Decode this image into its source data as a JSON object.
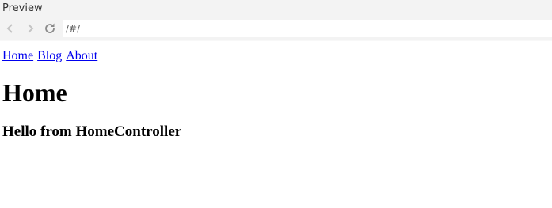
{
  "window": {
    "title": "Preview"
  },
  "toolbar": {
    "back_icon": "chevron-left-icon",
    "forward_icon": "chevron-right-icon",
    "refresh_icon": "refresh-icon",
    "url": "/#/"
  },
  "nav_links": [
    {
      "label": "Home"
    },
    {
      "label": "Blog"
    },
    {
      "label": "About"
    }
  ],
  "page": {
    "heading": "Home",
    "subheading": "Hello from HomeController"
  },
  "colors": {
    "chrome_bg": "#f3f3f3",
    "link": "#0000ee",
    "icon": "#bdbdbd",
    "icon_active": "#8a8a8a"
  }
}
